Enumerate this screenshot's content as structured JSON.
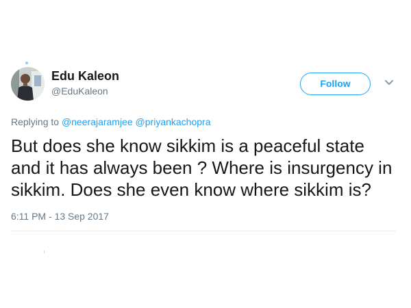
{
  "user": {
    "display_name": "Edu Kaleon",
    "handle": "@EduKaleon",
    "avatar_icon": "profile-photo"
  },
  "actions": {
    "follow_label": "Follow",
    "menu_icon": "chevron-down-icon"
  },
  "reply": {
    "prefix": "Replying to",
    "mentions": [
      "@neerajaramjee",
      "@priyankachopra"
    ]
  },
  "tweet": {
    "text": "But does she know sikkim is a peaceful state and it has always been ? Where is insurgency in sikkim. Does she even know where sikkim is?",
    "timestamp": "6:11 PM - 13 Sep 2017"
  },
  "colors": {
    "accent": "#1da1f2",
    "secondary_text": "#657786",
    "primary_text": "#14171a",
    "divider": "#e6ecf0"
  }
}
